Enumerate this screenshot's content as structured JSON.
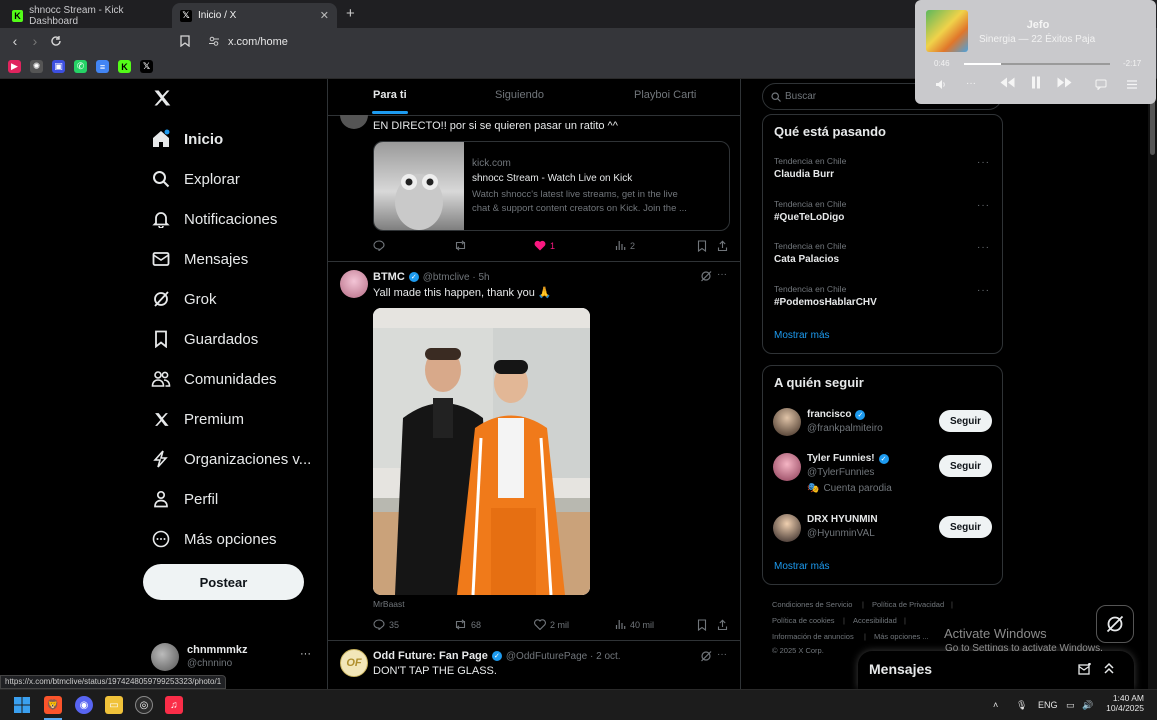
{
  "browser": {
    "tabs": [
      {
        "title": "shnocc Stream - Kick Dashboard",
        "active": false
      },
      {
        "title": "Inicio / X",
        "active": true
      }
    ],
    "url": "x.com/home",
    "status_url": "https://x.com/btmclive/status/1974248059799253323/photo/1"
  },
  "sidebar": {
    "items": [
      {
        "label": "Inicio",
        "icon": "home-icon",
        "active": true
      },
      {
        "label": "Explorar",
        "icon": "search-icon"
      },
      {
        "label": "Notificaciones",
        "icon": "bell-icon"
      },
      {
        "label": "Mensajes",
        "icon": "mail-icon"
      },
      {
        "label": "Grok",
        "icon": "grok-icon"
      },
      {
        "label": "Guardados",
        "icon": "bookmark-icon"
      },
      {
        "label": "Comunidades",
        "icon": "people-icon"
      },
      {
        "label": "Premium",
        "icon": "x-logo-icon"
      },
      {
        "label": "Organizaciones v...",
        "icon": "lightning-icon"
      },
      {
        "label": "Perfil",
        "icon": "person-icon"
      },
      {
        "label": "Más opciones",
        "icon": "more-circle-icon"
      }
    ],
    "post_label": "Postear",
    "account": {
      "name": "chnmmmkz",
      "handle": "@chnnino"
    }
  },
  "feed": {
    "tabs": [
      "Para ti",
      "Siguiendo",
      "Playboi Carti"
    ],
    "tweet1": {
      "text": "EN DIRECTO!! por si se quieren pasar un ratito ^^",
      "card": {
        "domain": "kick.com",
        "title": "shnocc Stream - Watch Live on Kick",
        "desc1": "Watch shnocc's latest live streams, get in the live",
        "desc2": "chat & support content creators on Kick. Join the ..."
      },
      "likes": "1",
      "views": "2"
    },
    "tweet2": {
      "name": "BTMC",
      "handle": "@btmclive · 5h",
      "text": "Yall made this happen, thank you 🙏",
      "media_credit": "MrBaast",
      "replies": "35",
      "reposts": "68",
      "likes": "2 mil",
      "views": "40 mil"
    },
    "tweet3": {
      "name": "Odd Future: Fan Page",
      "handle": "@OddFuturePage · 2 oct.",
      "text": "DON'T TAP THE GLASS."
    }
  },
  "right": {
    "search_placeholder": "Buscar",
    "trends_title": "Qué está pasando",
    "trends": [
      {
        "context": "Tendencia en Chile",
        "name": "Claudia Burr"
      },
      {
        "context": "Tendencia en Chile",
        "name": "#QueTeLoDigo"
      },
      {
        "context": "Tendencia en Chile",
        "name": "Cata Palacios"
      },
      {
        "context": "Tendencia en Chile",
        "name": "#PodemosHablarCHV"
      }
    ],
    "show_more": "Mostrar más",
    "follow_title": "A quién seguir",
    "follow": [
      {
        "name": "francisco",
        "handle": "@frankpalmiteiro",
        "extra": ""
      },
      {
        "name": "Tyler Funnies!",
        "handle": "@TylerFunnies",
        "extra": "Cuenta parodia"
      },
      {
        "name": "DRX HYUNMIN",
        "handle": "@HyunminVAL",
        "extra": ""
      }
    ],
    "follow_label": "Seguir",
    "footer": [
      "Condiciones de Servicio",
      "Política de Privacidad",
      "Política de cookies",
      "Accesibilidad",
      "Información de anuncios",
      "Más opciones ...",
      "© 2025 X Corp."
    ]
  },
  "media_player": {
    "title": "Jefo",
    "subtitle": "Sinergia — 22 Éxitos Paja",
    "elapsed": "0:46",
    "remaining": "-2:17",
    "progress": 0.25
  },
  "messages_dock": {
    "label": "Mensajes"
  },
  "windows": {
    "watermark_title": "Activate Windows",
    "watermark_sub": "Go to Settings to activate Windows.",
    "lang": "ENG",
    "time": "1:40 AM",
    "date": "10/4/2025"
  },
  "colors": {
    "accent": "#1d9bf0",
    "like": "#f91880",
    "background": "#000000"
  }
}
